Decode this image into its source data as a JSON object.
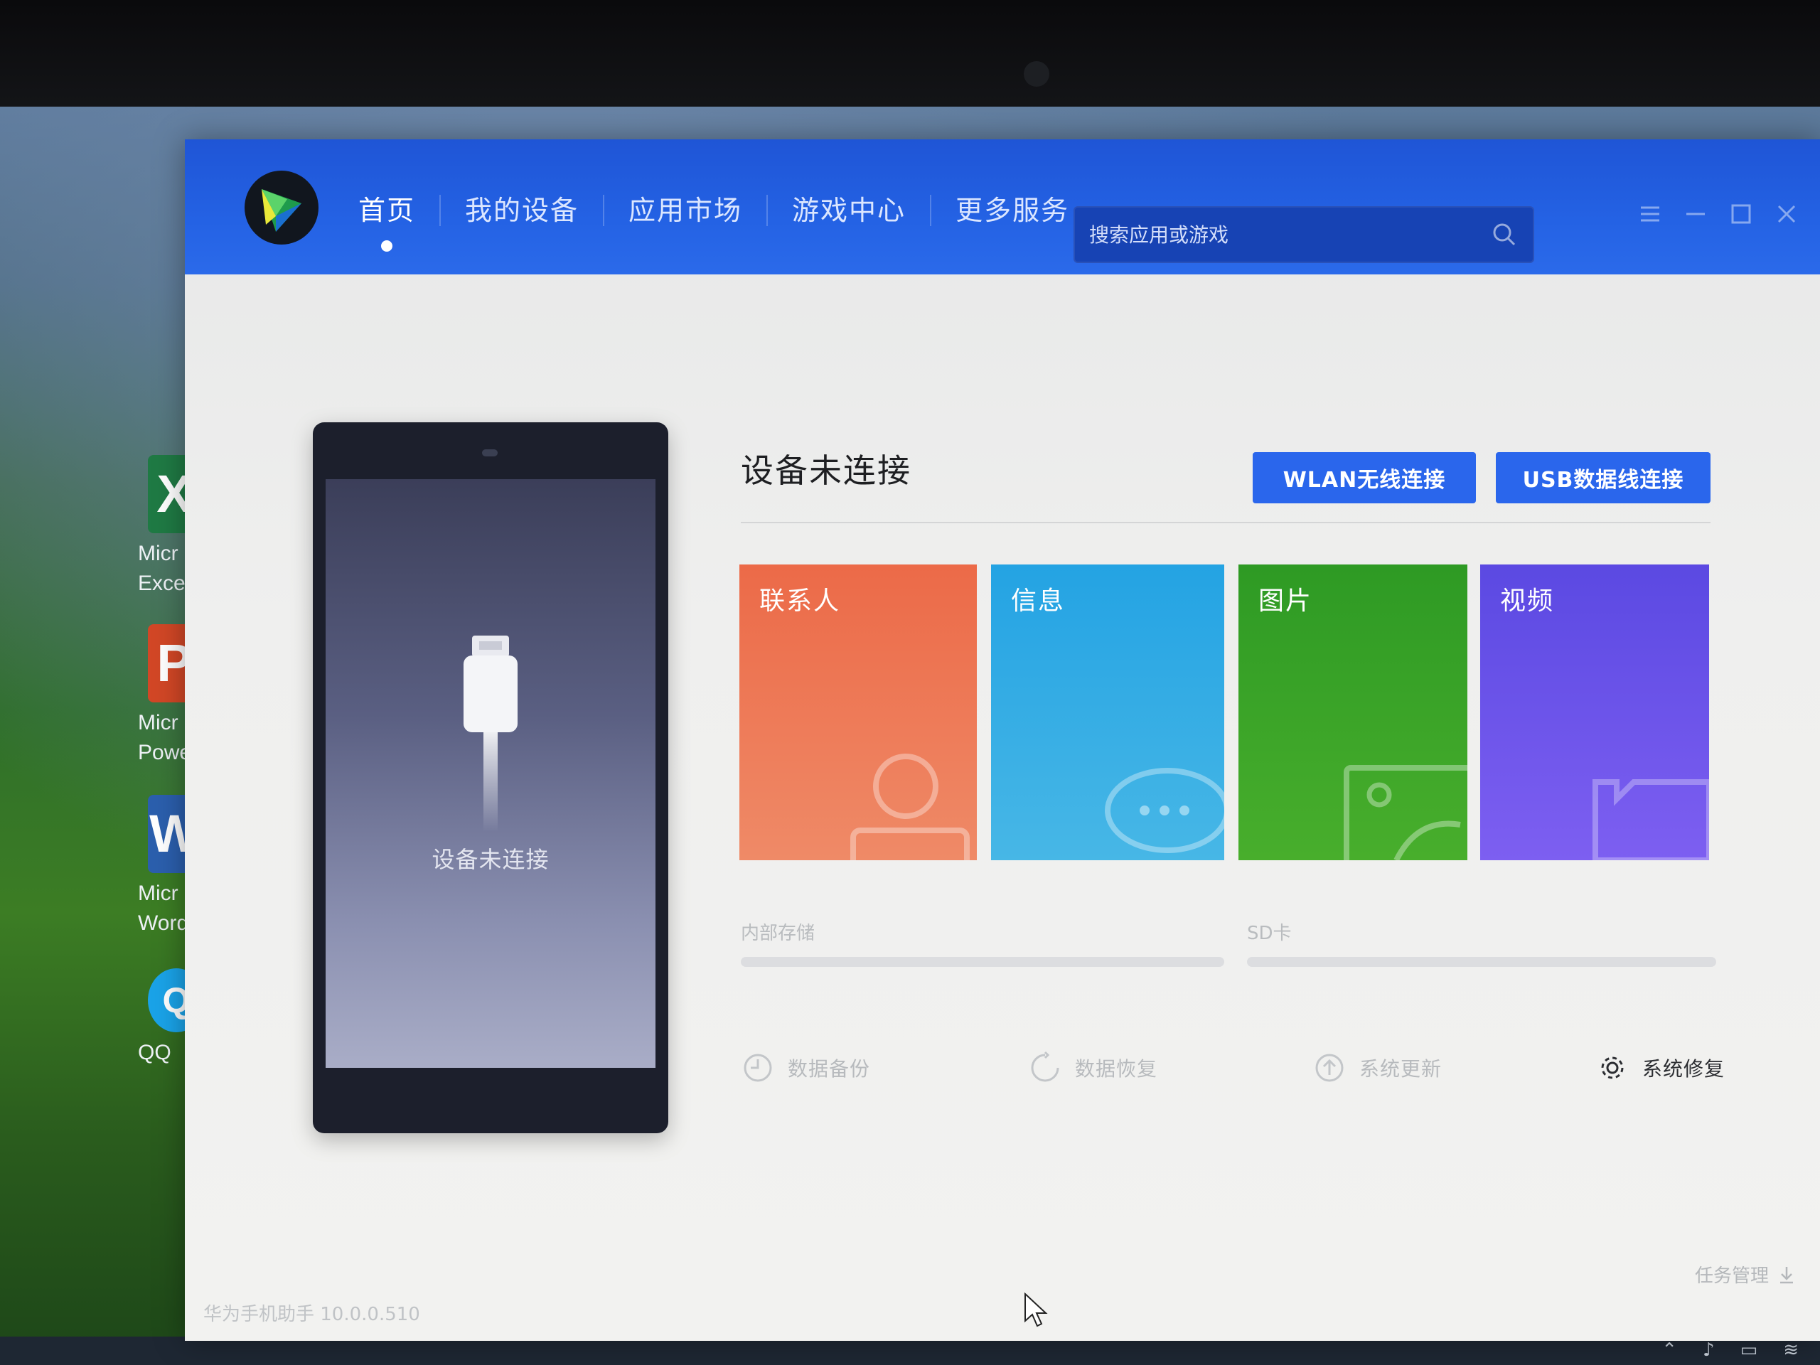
{
  "app": {
    "version_text": "华为手机助手 10.0.0.510"
  },
  "nav": {
    "items": [
      {
        "label": "首页",
        "active": true
      },
      {
        "label": "我的设备",
        "active": false
      },
      {
        "label": "应用市场",
        "active": false
      },
      {
        "label": "游戏中心",
        "active": false
      },
      {
        "label": "更多服务",
        "active": false
      }
    ]
  },
  "search": {
    "placeholder": "搜索应用或游戏"
  },
  "phone": {
    "status_text": "设备未连接"
  },
  "connection": {
    "title": "设备未连接",
    "wlan_button": "WLAN无线连接",
    "usb_button": "USB数据线连接"
  },
  "tiles": [
    {
      "label": "联系人",
      "icon": "contact-icon"
    },
    {
      "label": "信息",
      "icon": "message-icon"
    },
    {
      "label": "图片",
      "icon": "photo-icon"
    },
    {
      "label": "视频",
      "icon": "video-icon"
    }
  ],
  "storage": {
    "internal_label": "内部存储",
    "sd_label": "SD卡"
  },
  "actions": [
    {
      "label": "数据备份",
      "icon": "backup-icon",
      "enabled": false
    },
    {
      "label": "数据恢复",
      "icon": "restore-icon",
      "enabled": false
    },
    {
      "label": "系统更新",
      "icon": "update-icon",
      "enabled": false
    },
    {
      "label": "系统修复",
      "icon": "gear-icon",
      "enabled": true
    }
  ],
  "footer": {
    "task_manager": "任务管理"
  },
  "desktop": {
    "icons": [
      {
        "line1": "Micr",
        "line2": "Exce",
        "glyph": "X"
      },
      {
        "line1": "Micr",
        "line2": "Powe",
        "glyph": "P"
      },
      {
        "line1": "Micr",
        "line2": "Word",
        "glyph": "W"
      },
      {
        "line1": "QQ",
        "line2": "",
        "glyph": "Q"
      }
    ]
  },
  "colors": {
    "titlebar": "#2462e4",
    "button": "#2a66ec",
    "contacts": "#ec6a48",
    "messages": "#24a3e3",
    "photos": "#2e9a24",
    "videos": "#5b49e2"
  }
}
